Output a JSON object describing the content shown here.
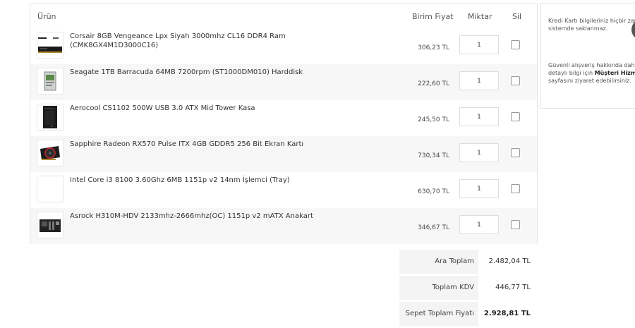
{
  "table": {
    "col_product": "Ürün",
    "col_unit_price": "Birim Fiyat",
    "col_quantity": "Miktar",
    "col_delete": "Sil"
  },
  "items": [
    {
      "name": "Corsair 8GB Vengeance Lpx Siyah 3000mhz CL16 DDR4 Ram (CMK8GX4M1D3000C16)",
      "price": "306,23 TL",
      "qty": "1",
      "thumb": "ram-thumbnail"
    },
    {
      "name": "Seagate 1TB Barracuda 64MB 7200rpm (ST1000DM010) Harddisk",
      "price": "222,60 TL",
      "qty": "1",
      "thumb": "harddisk-thumbnail"
    },
    {
      "name": "Aerocool CS1102 500W USB 3.0 ATX Mid Tower Kasa",
      "price": "245,50 TL",
      "qty": "1",
      "thumb": "case-thumbnail"
    },
    {
      "name": "Sapphire Radeon RX570 Pulse ITX 4GB GDDR5 256 Bit Ekran Kartı",
      "price": "730,34 TL",
      "qty": "1",
      "thumb": "gpu-thumbnail"
    },
    {
      "name": "Intel Core i3 8100 3.60Ghz 6MB 1151p v2 14nm İşlemci (Tray)",
      "price": "630,70 TL",
      "qty": "1",
      "thumb": "empty-thumbnail"
    },
    {
      "name": "Asrock H310M-HDV 2133mhz-2666mhz(OC) 1151p v2 mATX Anakart",
      "price": "346,67 TL",
      "qty": "1",
      "thumb": "motherboard-thumbnail"
    }
  ],
  "totals": {
    "subtotal_label": "Ara Toplam",
    "subtotal_value": "2.482,04 TL",
    "vat_label": "Toplam KDV",
    "vat_value": "446,77 TL",
    "grand_label": "Sepet Toplam Fiyatı",
    "grand_value": "2.928,81 TL"
  },
  "info": {
    "security_note": "Kredi Kartı bilgileriniz hiçbir zaman sistemde saklanmaz.",
    "help_prefix": "Güvenli alışveriş hakkında daha detaylı bilgi için ",
    "help_link": "Müşteri Hizmetleri",
    "help_suffix": " sayfasını ziyaret edebilirsiniz."
  }
}
